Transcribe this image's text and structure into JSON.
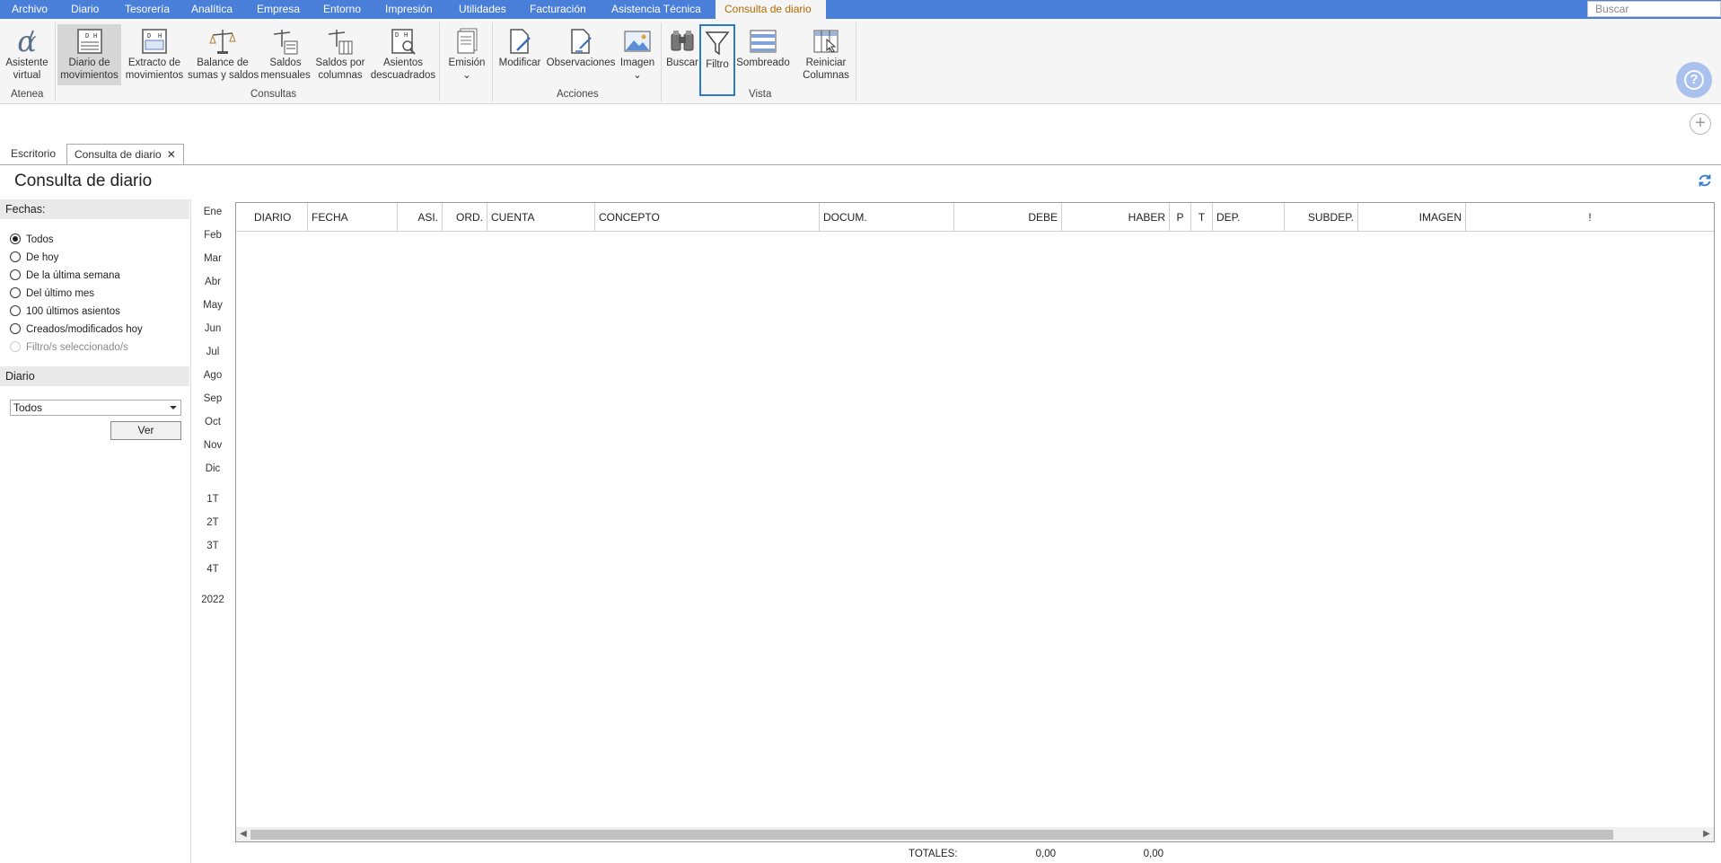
{
  "menu": {
    "items": [
      "Archivo",
      "Diario",
      "Tesorería",
      "Analítica",
      "Empresa",
      "Entorno",
      "Impresión",
      "Utilidades",
      "Facturación",
      "Asistencia Técnica"
    ],
    "active": "Consulta de diario",
    "search_placeholder": "Buscar"
  },
  "ribbon": {
    "atenea": {
      "button1": "Asistente",
      "button2": "virtual",
      "group": "Atenea"
    },
    "consultas": {
      "group": "Consultas",
      "b1": [
        "Diario de",
        "movimientos"
      ],
      "b2": [
        "Extracto de",
        "movimientos"
      ],
      "b3": [
        "Balance de",
        "sumas y saldos"
      ],
      "b4": [
        "Saldos",
        "mensuales"
      ],
      "b5": [
        "Saldos por",
        "columnas"
      ],
      "b6": [
        "Asientos",
        "descuadrados"
      ],
      "b7": "Emisión"
    },
    "acciones": {
      "group": "Acciones",
      "b1": "Modificar",
      "b2": "Observaciones",
      "b3": "Imagen"
    },
    "vista": {
      "group": "Vista",
      "b1": "Buscar",
      "b2": "Filtro",
      "b3": "Sombreado",
      "b4": [
        "Reiniciar",
        "Columnas"
      ]
    }
  },
  "tabs": {
    "escritorio": "Escritorio",
    "consulta": "Consulta de diario"
  },
  "page_title": "Consulta de diario",
  "filters": {
    "fechas_label": "Fechas:",
    "options": [
      "Todos",
      "De hoy",
      "De la última semana",
      "Del último mes",
      "100 últimos asientos",
      "Creados/modificados hoy",
      "Filtro/s seleccionado/s"
    ],
    "selected_index": 0,
    "diario_label": "Diario",
    "diario_value": "Todos",
    "ver_button": "Ver"
  },
  "months": [
    "Ene",
    "Feb",
    "Mar",
    "Abr",
    "May",
    "Jun",
    "Jul",
    "Ago",
    "Sep",
    "Oct",
    "Nov",
    "Dic"
  ],
  "quarters": [
    "1T",
    "2T",
    "3T",
    "4T"
  ],
  "year": "2022",
  "grid": {
    "columns": [
      "DIARIO",
      "FECHA",
      "ASI.",
      "ORD.",
      "CUENTA",
      "CONCEPTO",
      "DOCUM.",
      "DEBE",
      "HABER",
      "P",
      "T",
      "DEP.",
      "SUBDEP.",
      "IMAGEN",
      "!"
    ]
  },
  "totals": {
    "label": "TOTALES:",
    "debe": "0,00",
    "haber": "0,00"
  },
  "colors": {
    "menubar": "#4a7fd9",
    "accent": "#2a7bd0",
    "active_tab_text": "#b06a00"
  }
}
